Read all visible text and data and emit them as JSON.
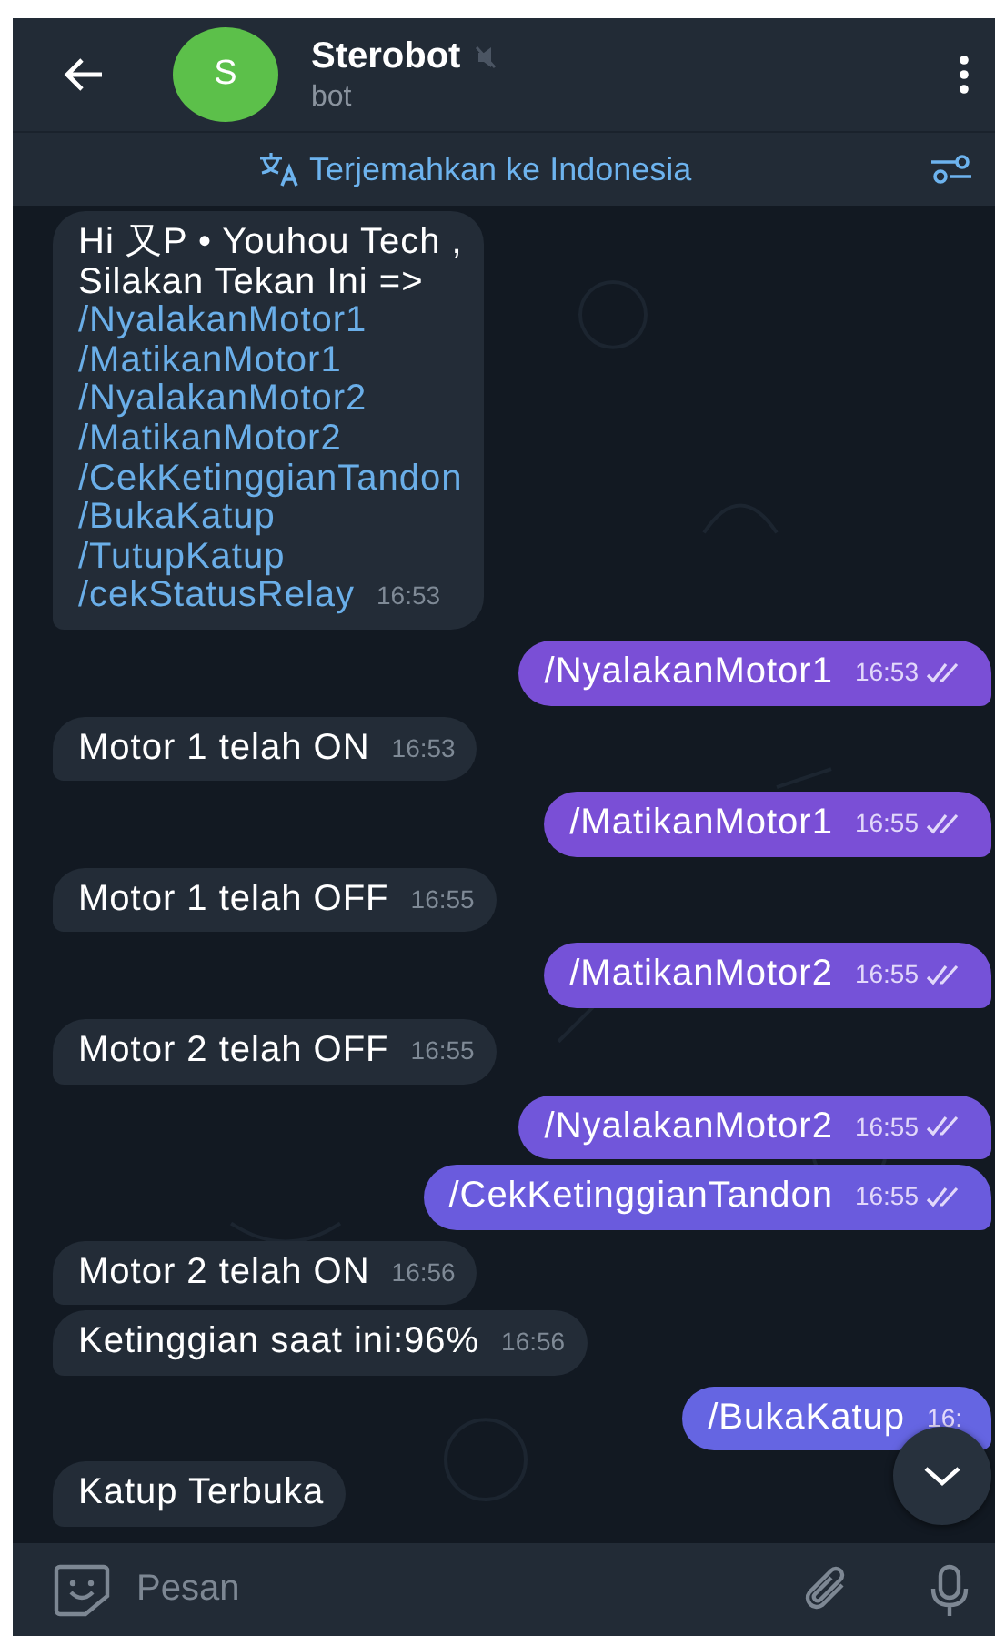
{
  "header": {
    "avatar_letter": "S",
    "title": "Sterobot",
    "muted": true,
    "subtitle": "bot"
  },
  "translate_bar": {
    "label": "Terjemahkan ke Indonesia"
  },
  "messages": [
    {
      "kind": "incoming",
      "lines": [
        {
          "kind": "text",
          "text": "Hi 又P • Youhou Tech ,"
        },
        {
          "kind": "text",
          "text": "Silakan Tekan Ini =>"
        },
        {
          "kind": "command",
          "text": "/NyalakanMotor1"
        },
        {
          "kind": "command",
          "text": "/MatikanMotor1"
        },
        {
          "kind": "command",
          "text": "/NyalakanMotor2"
        },
        {
          "kind": "command",
          "text": "/MatikanMotor2"
        },
        {
          "kind": "command",
          "text": "/CekKetinggianTandon"
        },
        {
          "kind": "command",
          "text": "/BukaKatup"
        },
        {
          "kind": "command",
          "text": "/TutupKatup"
        },
        {
          "kind": "command",
          "text": "/cekStatusRelay"
        }
      ],
      "time": "16:53"
    },
    {
      "kind": "outgoing",
      "lines": [
        {
          "kind": "text",
          "text": "/NyalakanMotor1"
        }
      ],
      "time": "16:53",
      "read": true,
      "color": "#7a4fd6"
    },
    {
      "kind": "incoming",
      "lines": [
        {
          "kind": "text",
          "text": "Motor 1 telah ON"
        }
      ],
      "time": "16:53"
    },
    {
      "kind": "outgoing",
      "lines": [
        {
          "kind": "text",
          "text": "/MatikanMotor1"
        }
      ],
      "time": "16:55",
      "read": true,
      "color": "#7a4fd6"
    },
    {
      "kind": "incoming",
      "lines": [
        {
          "kind": "text",
          "text": "Motor 1 telah OFF"
        }
      ],
      "time": "16:55"
    },
    {
      "kind": "outgoing",
      "lines": [
        {
          "kind": "text",
          "text": "/MatikanMotor2"
        }
      ],
      "time": "16:55",
      "read": true,
      "color": "#7552d8"
    },
    {
      "kind": "incoming",
      "lines": [
        {
          "kind": "text",
          "text": "Motor 2 telah OFF"
        }
      ],
      "time": "16:55"
    },
    {
      "kind": "outgoing",
      "lines": [
        {
          "kind": "text",
          "text": "/NyalakanMotor2"
        }
      ],
      "time": "16:55",
      "read": true,
      "color": "#7156da"
    },
    {
      "kind": "outgoing",
      "lines": [
        {
          "kind": "text",
          "text": "/CekKetinggianTandon"
        }
      ],
      "time": "16:55",
      "read": true,
      "color": "#6a5bdd"
    },
    {
      "kind": "incoming",
      "lines": [
        {
          "kind": "text",
          "text": "Motor 2 telah ON"
        }
      ],
      "time": "16:56"
    },
    {
      "kind": "incoming",
      "lines": [
        {
          "kind": "text",
          "text": "Ketinggian saat ini:96%"
        }
      ],
      "time": "16:56"
    },
    {
      "kind": "outgoing",
      "lines": [
        {
          "kind": "text",
          "text": "/BukaKatup"
        }
      ],
      "time": "16:",
      "color": "#6565e2"
    },
    {
      "kind": "incoming",
      "lines": [
        {
          "kind": "text",
          "text": "Katup Terbuka"
        }
      ]
    }
  ],
  "input": {
    "placeholder": "Pesan"
  }
}
